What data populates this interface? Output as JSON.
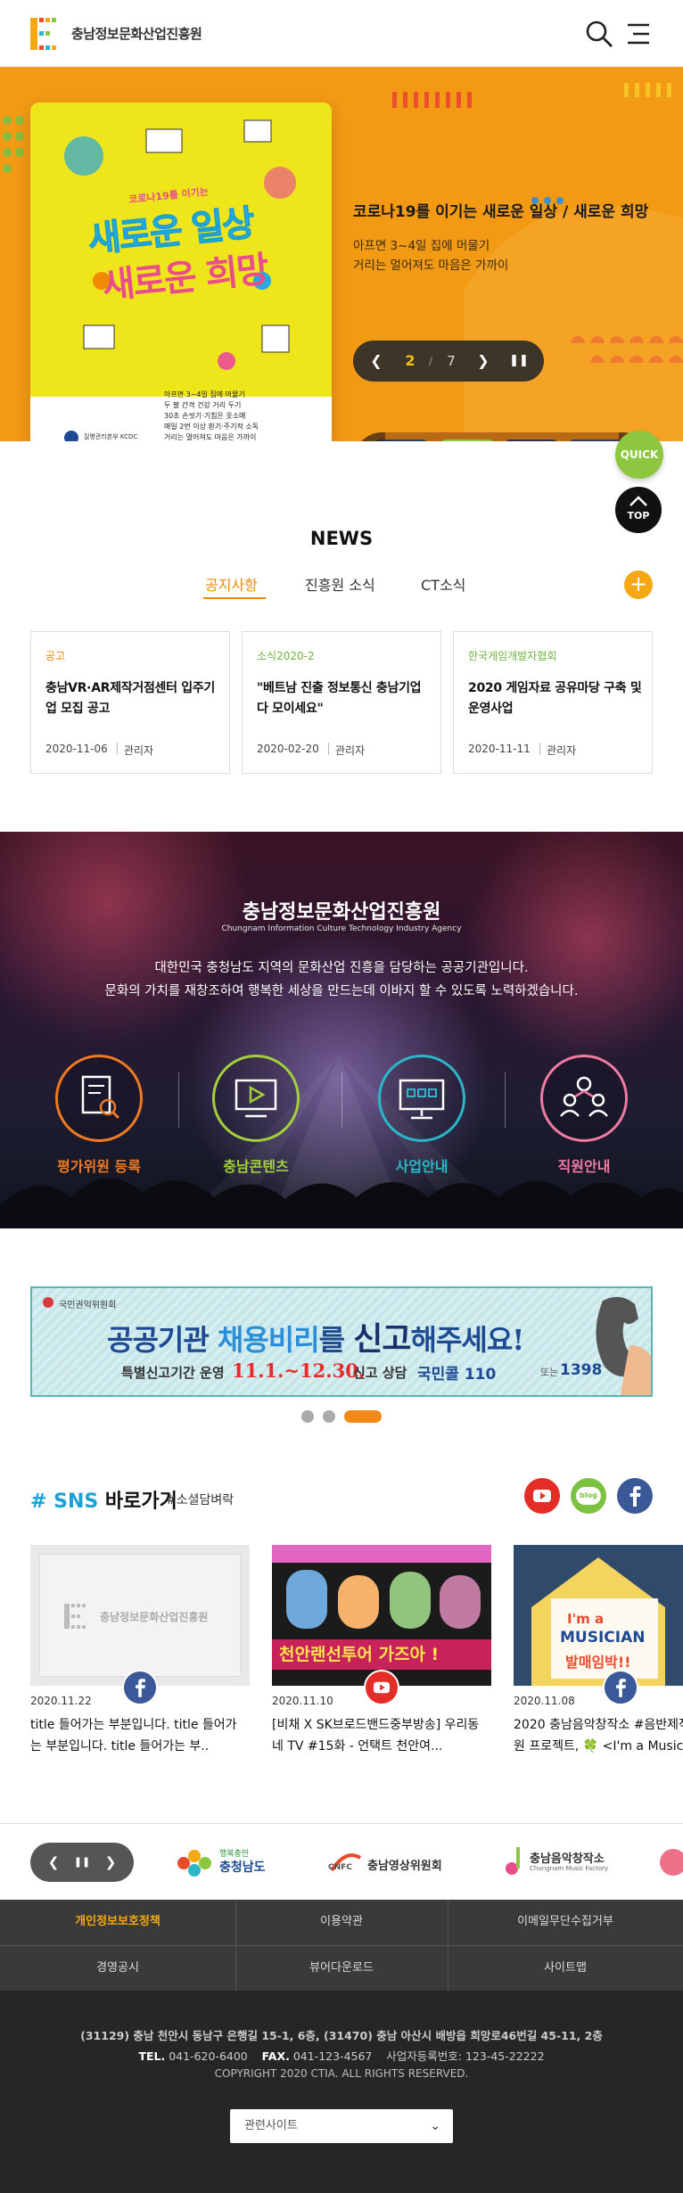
{
  "header": {
    "logo_text": "충남정보문화산업진흥원"
  },
  "hero": {
    "title": "코로나19를 이기는 새로운 일상 / 새로운 희망",
    "subtitle_line1": "아프면 3~4일 집에 머물기",
    "subtitle_line2": "거리는 멀어져도 마음은 가까이",
    "slide_current": "2",
    "slide_separator": "/",
    "slide_total": "7",
    "poster": {
      "top_caption": "코로나19를 이기는",
      "headline1": "새로운 일상",
      "headline2": "새로운 희망",
      "rules": [
        "아프면 3~4일 집에 머물기",
        "두 팔 간격 건강 거리 두기",
        "30초 손씻기·기침은 옷소매",
        "매일 2번 이상 환기·주기적 소독",
        "거리는 멀어져도 마음은 가까이"
      ],
      "agency": "질병관리본부 KCDC"
    }
  },
  "quick": {
    "quick_label": "QUICK",
    "top_label": "TOP"
  },
  "news": {
    "title": "NEWS",
    "tabs": [
      "공지사항",
      "진흥원 소식",
      "CT소식"
    ],
    "items": [
      {
        "category": "공고",
        "title": "충남VR·AR제작거점센터 입주기업 모집 공고",
        "date": "2020-11-06",
        "author": "관리자",
        "color": "#f08a00"
      },
      {
        "category": "소식2020-2",
        "title": "\"베트남 진출 정보통신 충남기업 다 모이세요\"",
        "date": "2020-02-20",
        "author": "관리자",
        "color": "#6cb33f"
      },
      {
        "category": "한국게임개발자협회",
        "title": "2020 게임자료 공유마당 구축 및 운영사업",
        "date": "2020-11-11",
        "author": "관리자",
        "color": "#6cb33f"
      }
    ]
  },
  "intro": {
    "title": "충남정보문화산업진흥원",
    "title_en": "Chungnam Information Culture Technology Industry Agency",
    "desc_line1": "대한민국 충청남도 지역의 문화산업 진흥을 담당하는 공공기관입니다.",
    "desc_line2": "문화의 가치를 재창조하여 행복한 세상을 만드는데 이바지 할 수 있도록 노력하겠습니다.",
    "items": [
      {
        "label": "평가위원 등록",
        "color": "#f07a22"
      },
      {
        "label": "충남콘텐츠",
        "color": "#a4cf3c"
      },
      {
        "label": "사업안내",
        "color": "#2ab7c9"
      },
      {
        "label": "직원안내",
        "color": "#f07aa2"
      }
    ]
  },
  "banner": {
    "org": "국민권익위원회",
    "main_a": "공공기관 ",
    "main_b": "채용비리",
    "main_c": "를 ",
    "main_d": "신고",
    "main_e": "해주세요!",
    "sub": "특별신고기간 운영",
    "date": "11.1.~12.30.",
    "consult": "신고 상담",
    "tel": "국민콜 110",
    "or": "또는",
    "num": "1398"
  },
  "sns": {
    "hash": "# SNS",
    "title": " 바로가기",
    "tag": "#소셜담벼락",
    "blog_label": "blog",
    "placeholder_logo": "충남정보문화산업진흥원",
    "posts": [
      {
        "date": "2020.11.22",
        "text1": "title 들어가는 부분입니다. title 들어가",
        "text2": "는 부분입니다. title 들어가는 부.."
      },
      {
        "date": "2020.11.10",
        "text1": "[비채 X SK브로드밴드중부방송] 우리동",
        "text2": "네 TV #15화 - 언택트 천안여..."
      },
      {
        "date": "2020.11.08",
        "text1": "2020 충남음악창작소 #음반제작지",
        "text2": "원 프로젝트, 🍀 <I'm a Music"
      }
    ],
    "card2_strip": "천안랜선투어 가즈아 !",
    "card3_sign1": "I'm a",
    "card3_sign2": "MUSICIAN",
    "card3_sign3": "발매임박!!"
  },
  "partners": {
    "logos": [
      {
        "name": "행복충만 충청남도",
        "line1": "행복충만",
        "line2": "충청남도"
      },
      {
        "name": "충남영상위원회",
        "line1": "CNFC",
        "line2": "충남영상위원회"
      },
      {
        "name": "충남음악창작소",
        "line1": "충남음악창작소",
        "line2": "Chungnam Music Factory"
      }
    ]
  },
  "footer": {
    "links_row1": [
      "개인정보보호정책",
      "이용약관",
      "이메일무단수집거부"
    ],
    "links_row2": [
      "경영공시",
      "뷰어다운로드",
      "사이트맵"
    ],
    "address": "(31129) 충남 천안시 동남구 은행길 15-1, 6층, (31470) 충남 아산시 배방읍 희망로46번길 45-11, 2층",
    "tel_label": "TEL.",
    "tel": "041-620-6400",
    "fax_label": "FAX.",
    "fax": "041-123-4567",
    "bizno": "사업자등록번호: 123-45-22222",
    "copyright": "COPYRIGHT 2020 CTIA. ALL RIGHTS RESERVED.",
    "related_sites": "관련사이트"
  }
}
